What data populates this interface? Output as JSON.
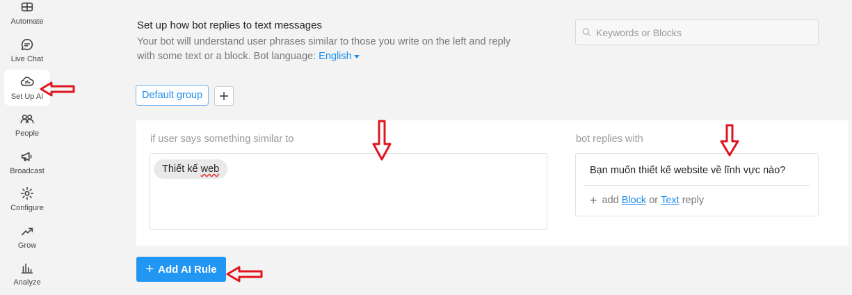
{
  "sidebar": {
    "items": [
      {
        "label": "Automate",
        "icon": "automate-icon",
        "active": false
      },
      {
        "label": "Live Chat",
        "icon": "chat-bubble-icon",
        "active": false
      },
      {
        "label": "Set Up AI",
        "icon": "brain-cloud-icon",
        "active": true
      },
      {
        "label": "People",
        "icon": "people-icon",
        "active": false
      },
      {
        "label": "Broadcast",
        "icon": "megaphone-icon",
        "active": false
      },
      {
        "label": "Configure",
        "icon": "gear-icon",
        "active": false
      },
      {
        "label": "Grow",
        "icon": "trend-up-icon",
        "active": false
      },
      {
        "label": "Analyze",
        "icon": "bar-chart-icon",
        "active": false
      }
    ]
  },
  "header": {
    "title": "Set up how bot replies to text messages",
    "description": "Your bot will understand user phrases similar to those you write on the left and reply with some text or a block. Bot language:",
    "language": "English"
  },
  "search": {
    "placeholder": "Keywords or Blocks"
  },
  "groups": {
    "active_label": "Default group",
    "add_label": "+"
  },
  "rule": {
    "user_says_label": "if user says something similar to",
    "phrase_part1": "Thiết kế ",
    "phrase_part2": "web",
    "bot_replies_label": "bot replies with",
    "reply_text": "Bạn muốn thiết kế website về lĩnh vực nào?",
    "add_label": "add",
    "block_link": "Block",
    "or_label": "or",
    "text_link": "Text",
    "reply_label": "reply"
  },
  "add_rule_button": {
    "plus": "+",
    "label": "Add AI Rule"
  },
  "colors": {
    "accent": "#2196f3",
    "link": "#1f8ceb",
    "annotation": "#e0141e"
  }
}
